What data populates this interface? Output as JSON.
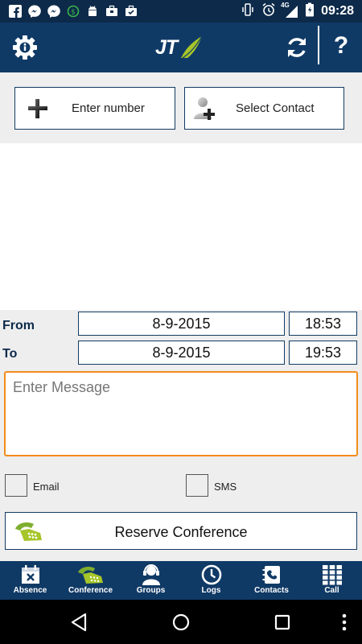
{
  "status_bar": {
    "time": "09:28",
    "network": "4G",
    "left_icons": [
      "facebook-icon",
      "messenger-icon",
      "messenger-icon",
      "money-icon",
      "android-icon",
      "briefcase-icon",
      "briefcase-check-icon"
    ],
    "right_icons": [
      "vibrate-icon",
      "alarm-icon",
      "signal-icon",
      "battery-icon"
    ]
  },
  "app_bar": {
    "logo_text": "JT",
    "icons": [
      "settings-icon",
      "refresh-icon",
      "help-icon"
    ],
    "help_label": "?"
  },
  "actions": {
    "enter_number_label": "Enter number",
    "select_contact_label": "Select Contact"
  },
  "form": {
    "from_label": "From",
    "to_label": "To",
    "from_date": "8-9-2015",
    "from_time": "18:53",
    "to_date": "8-9-2015",
    "to_time": "19:53",
    "message_placeholder": "Enter Message",
    "message_value": "",
    "email_label": "Email",
    "email_checked": false,
    "sms_label": "SMS",
    "sms_checked": false,
    "reserve_label": "Reserve Conference"
  },
  "bottom_nav": {
    "items": [
      {
        "label": "Absence",
        "icon": "calendar-x-icon"
      },
      {
        "label": "Conference",
        "icon": "conference-phone-icon"
      },
      {
        "label": "Groups",
        "icon": "headset-icon"
      },
      {
        "label": "Logs",
        "icon": "clock-icon"
      },
      {
        "label": "Contacts",
        "icon": "contacts-book-icon"
      },
      {
        "label": "Call",
        "icon": "dialpad-icon"
      }
    ]
  },
  "colors": {
    "primary": "#103a66",
    "status_bar": "#0d2a4a",
    "accent_orange": "#f28c1c",
    "logo_green": "#a6c52a",
    "panel_bg": "#eeeeee"
  }
}
